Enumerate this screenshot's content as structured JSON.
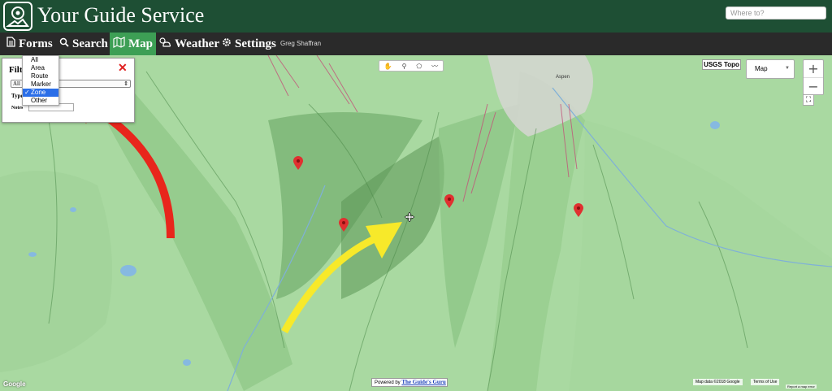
{
  "header": {
    "title": "Your Guide Service",
    "search_placeholder": "Where to?"
  },
  "nav": {
    "items": [
      {
        "label": "Forms",
        "icon": "document-icon"
      },
      {
        "label": "Search",
        "icon": "search-icon"
      },
      {
        "label": "Map",
        "icon": "map-icon",
        "active": true
      },
      {
        "label": "Weather",
        "icon": "weather-icon"
      },
      {
        "label": "Settings",
        "icon": "gear-icon"
      }
    ],
    "user": "Greg Shaffran"
  },
  "filter": {
    "title": "Filt",
    "close": "✕",
    "select_value": "All",
    "type_label": "Type",
    "notes_label": "Notes",
    "type_options": [
      "All",
      "Area",
      "Route",
      "Marker",
      "Zone",
      "Other"
    ],
    "type_selected": "Zone"
  },
  "map": {
    "layer_button": "USGS Topo",
    "map_type": "Map",
    "zoom_in": "+",
    "zoom_out": "−",
    "powered_prefix": "Powered by",
    "powered_link": "The Guide's Guru",
    "credit": "Map data ©2018 Google",
    "terms": "Terms of Use",
    "report": "Report a map error",
    "google": "Google",
    "town_label": "Aspen"
  },
  "colors": {
    "header_bg": "#1e4f34",
    "nav_bg": "#2a2a2a",
    "nav_active": "#3d9f55",
    "map_green": "#a8d8a0",
    "arrow_red": "#e8261c",
    "arrow_yellow": "#f7e92a",
    "pin_red": "#e03030"
  }
}
